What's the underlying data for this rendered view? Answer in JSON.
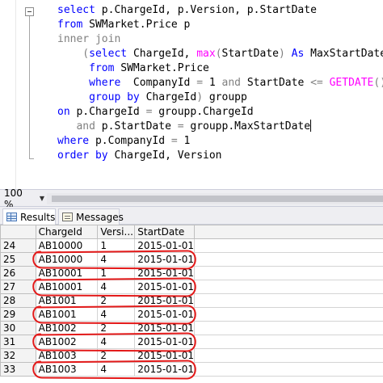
{
  "editor": {
    "lines": [
      [
        [
          "kw",
          "select "
        ],
        [
          "tx",
          "p.ChargeId, p.Version, p.StartDate"
        ]
      ],
      [
        [
          "kw",
          "from "
        ],
        [
          "tx",
          "SWMarket.Price p"
        ]
      ],
      [
        [
          "gy",
          "inner join"
        ]
      ],
      [
        [
          "gy",
          "    ("
        ],
        [
          "kw",
          "select "
        ],
        [
          "tx",
          "ChargeId, "
        ],
        [
          "fn",
          "max"
        ],
        [
          "gy",
          "("
        ],
        [
          "tx",
          "StartDate"
        ],
        [
          "gy",
          ") "
        ],
        [
          "kw",
          "As "
        ],
        [
          "tx",
          "MaxStartDate"
        ]
      ],
      [
        [
          "kw",
          "     from "
        ],
        [
          "tx",
          "SWMarket.Price"
        ]
      ],
      [
        [
          "kw",
          "     where  "
        ],
        [
          "tx",
          "CompanyId "
        ],
        [
          "gy",
          "= "
        ],
        [
          "tx",
          "1 "
        ],
        [
          "gy",
          "and "
        ],
        [
          "tx",
          "StartDate "
        ],
        [
          "gy",
          "<= "
        ],
        [
          "fn",
          "GETDATE"
        ],
        [
          "gy",
          "()"
        ]
      ],
      [
        [
          "kw",
          "     group by "
        ],
        [
          "tx",
          "ChargeId"
        ],
        [
          "gy",
          ") "
        ],
        [
          "tx",
          "groupp"
        ]
      ],
      [
        [
          "kw",
          "on "
        ],
        [
          "tx",
          "p.ChargeId "
        ],
        [
          "gy",
          "= "
        ],
        [
          "tx",
          "groupp.ChargeId"
        ]
      ],
      [
        [
          "gy",
          "   and "
        ],
        [
          "tx",
          "p.StartDate "
        ],
        [
          "gy",
          "= "
        ],
        [
          "tx",
          "groupp.MaxStartDate"
        ]
      ],
      [
        [
          "kw",
          "where "
        ],
        [
          "tx",
          "p.CompanyId "
        ],
        [
          "gy",
          "= "
        ],
        [
          "tx",
          "1"
        ]
      ],
      [
        [
          "kw",
          "order by "
        ],
        [
          "tx",
          "ChargeId, Version"
        ]
      ]
    ]
  },
  "zoom": {
    "value": "100 %"
  },
  "tabs": {
    "results": "Results",
    "messages": "Messages"
  },
  "grid": {
    "columns": [
      "",
      "ChargeId",
      "Versi...",
      "StartDate"
    ],
    "rows": [
      {
        "n": "24",
        "charge": "AB10000",
        "version": "1",
        "date": "2015-01-01",
        "circled": false
      },
      {
        "n": "25",
        "charge": "AB10000",
        "version": "4",
        "date": "2015-01-01",
        "circled": true
      },
      {
        "n": "26",
        "charge": "AB10001",
        "version": "1",
        "date": "2015-01-01",
        "circled": false
      },
      {
        "n": "27",
        "charge": "AB10001",
        "version": "4",
        "date": "2015-01-01",
        "circled": true
      },
      {
        "n": "28",
        "charge": "AB1001",
        "version": "2",
        "date": "2015-01-01",
        "circled": false
      },
      {
        "n": "29",
        "charge": "AB1001",
        "version": "4",
        "date": "2015-01-01",
        "circled": true
      },
      {
        "n": "30",
        "charge": "AB1002",
        "version": "2",
        "date": "2015-01-01",
        "circled": false
      },
      {
        "n": "31",
        "charge": "AB1002",
        "version": "4",
        "date": "2015-01-01",
        "circled": true
      },
      {
        "n": "32",
        "charge": "AB1003",
        "version": "2",
        "date": "2015-01-01",
        "circled": false
      },
      {
        "n": "33",
        "charge": "AB1003",
        "version": "4",
        "date": "2015-01-01",
        "circled": true
      }
    ]
  },
  "colors": {
    "annotation": "#e31919",
    "keyword": "#0000ff",
    "function": "#ff00ff",
    "operator": "#808080"
  }
}
